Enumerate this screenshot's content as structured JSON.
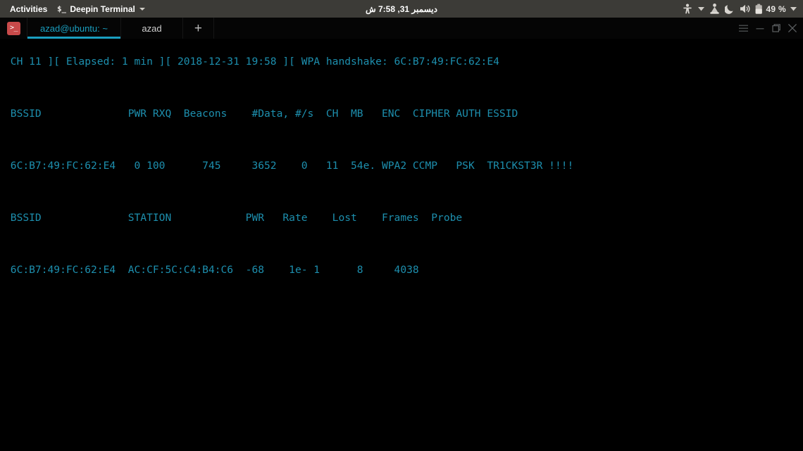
{
  "topbar": {
    "activities_label": "Activities",
    "app_menu": {
      "icon": "terminal-app-icon",
      "label": "Deepin Terminal",
      "caret": "chevron-down-icon"
    },
    "clock": "ديسمبر 31, 7:58 ش",
    "indicators": [
      {
        "name": "accessibility-icon"
      },
      {
        "name": "chevron-down-icon"
      },
      {
        "name": "tracker-icon"
      },
      {
        "name": "night-light-moon-icon"
      },
      {
        "name": "volume-icon"
      },
      {
        "name": "battery-icon"
      }
    ],
    "battery_label": "49 %"
  },
  "terminal_window": {
    "logo_glyph": ">_",
    "tabs": [
      {
        "label": "azad@ubuntu: ~",
        "active": true
      },
      {
        "label": "azad",
        "active": false
      }
    ],
    "new_tab_label": "+",
    "window_controls": [
      {
        "name": "menu-button",
        "icon": "hamburger-icon"
      },
      {
        "name": "minimize-button",
        "icon": "minimize-icon"
      },
      {
        "name": "maximize-button",
        "icon": "maximize-icon"
      },
      {
        "name": "close-button",
        "icon": "close-icon"
      }
    ]
  },
  "terminal": {
    "accent_color": "#1d8fae",
    "background_color": "#000000",
    "lines": [
      " CH 11 ][ Elapsed: 1 min ][ 2018-12-31 19:58 ][ WPA handshake: 6C:B7:49:FC:62:E4",
      "",
      " BSSID              PWR RXQ  Beacons    #Data, #/s  CH  MB   ENC  CIPHER AUTH ESSID",
      "",
      " 6C:B7:49:FC:62:E4   0 100      745     3652    0   11  54e. WPA2 CCMP   PSK  TR1CKST3R !!!!",
      "",
      " BSSID              STATION            PWR   Rate    Lost    Frames  Probe",
      "",
      " 6C:B7:49:FC:62:E4  AC:CF:5C:C4:B4:C6  -68    1e- 1      8     4038"
    ],
    "airodump": {
      "status": {
        "channel": "CH 11",
        "elapsed": "Elapsed: 1 min",
        "timestamp": "2018-12-31 19:58",
        "handshake": "WPA handshake: 6C:B7:49:FC:62:E4"
      },
      "ap_headers": [
        "BSSID",
        "PWR",
        "RXQ",
        "Beacons",
        "#Data,",
        "#/s",
        "CH",
        "MB",
        "ENC",
        "CIPHER",
        "AUTH",
        "ESSID"
      ],
      "ap_rows": [
        [
          "6C:B7:49:FC:62:E4",
          "0",
          "100",
          "745",
          "3652",
          "0",
          "11",
          "54e.",
          "WPA2",
          "CCMP",
          "PSK",
          "TR1CKST3R !!!!"
        ]
      ],
      "station_headers": [
        "BSSID",
        "STATION",
        "PWR",
        "Rate",
        "Lost",
        "Frames",
        "Probe"
      ],
      "station_rows": [
        [
          "6C:B7:49:FC:62:E4",
          "AC:CF:5C:C4:B4:C6",
          "-68",
          "1e- 1",
          "8",
          "4038",
          ""
        ]
      ]
    }
  }
}
